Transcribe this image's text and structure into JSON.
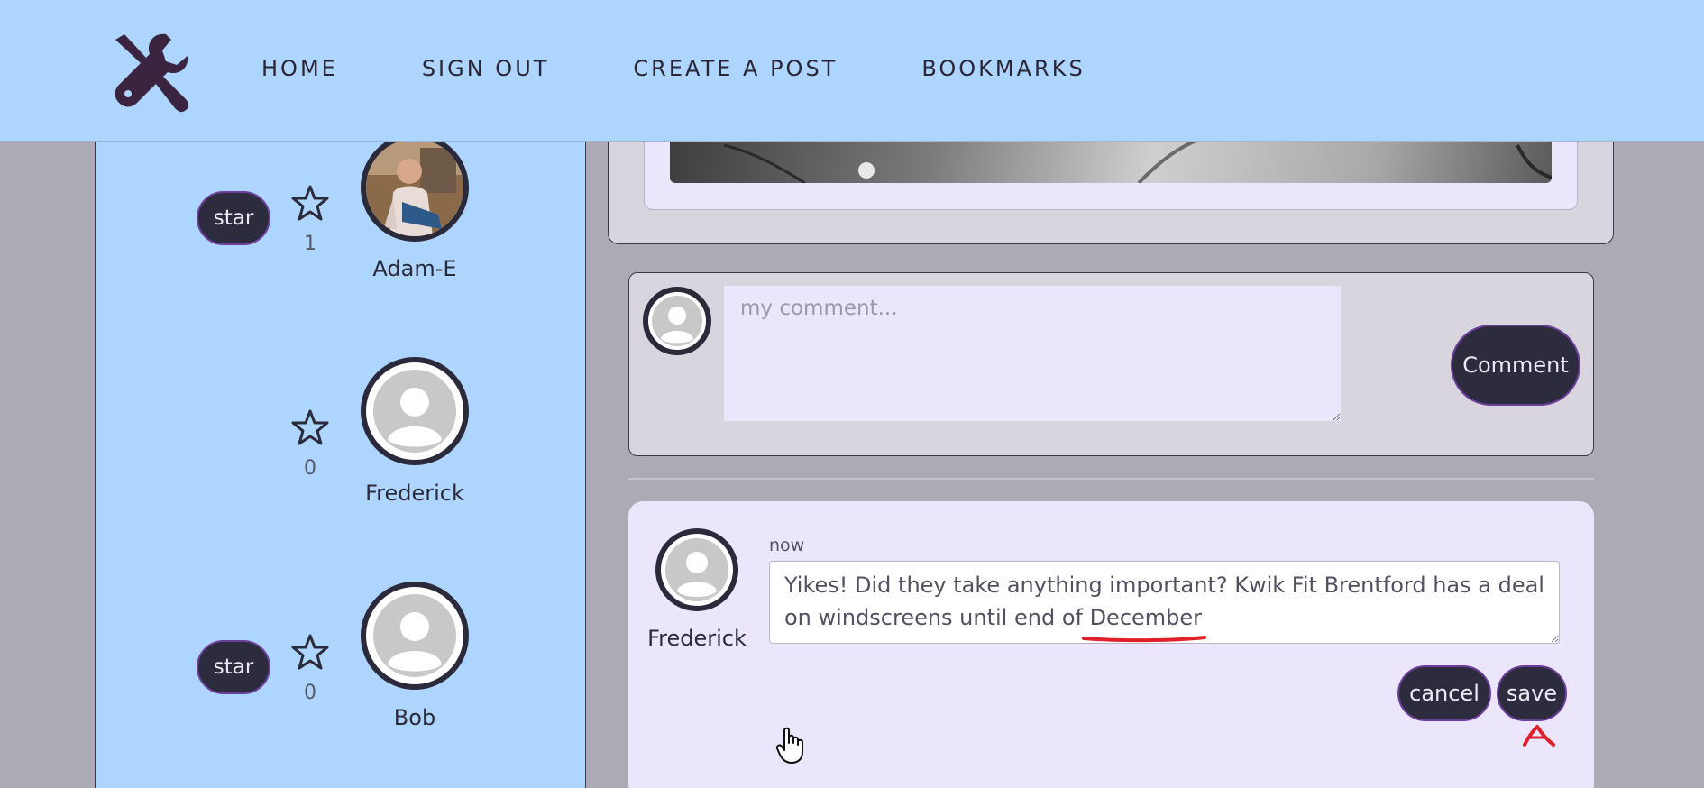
{
  "navbar": {
    "logo_icon": "wrench-screwdriver-logo",
    "links": [
      {
        "label": "HOME"
      },
      {
        "label": "SIGN OUT"
      },
      {
        "label": "CREATE A POST"
      },
      {
        "label": "BOOKMARKS"
      }
    ]
  },
  "sidebar": {
    "profiles": [
      {
        "username": "Adam-E",
        "star_label": "star",
        "star_count": "1",
        "has_star_button": true,
        "avatar": "photo"
      },
      {
        "username": "Frederick",
        "star_label": "",
        "star_count": "0",
        "has_star_button": false,
        "avatar": "default"
      },
      {
        "username": "Bob",
        "star_label": "star",
        "star_count": "0",
        "has_star_button": true,
        "avatar": "default"
      }
    ]
  },
  "comment_form": {
    "placeholder": "my comment...",
    "button_label": "Comment"
  },
  "comment": {
    "author": "Frederick",
    "time": "now",
    "text": "Yikes! Did they take anything important? Kwik Fit Brentford has a deal on windscreens until end of December",
    "cancel_label": "cancel",
    "save_label": "save"
  },
  "colors": {
    "navbar_bg": "#add5fd",
    "page_bg": "#acaab4",
    "button_bg": "#2d2c3e",
    "button_border": "#6b3f9a",
    "card_bg": "#ebe6fb",
    "annotation_red": "#e0202a"
  }
}
